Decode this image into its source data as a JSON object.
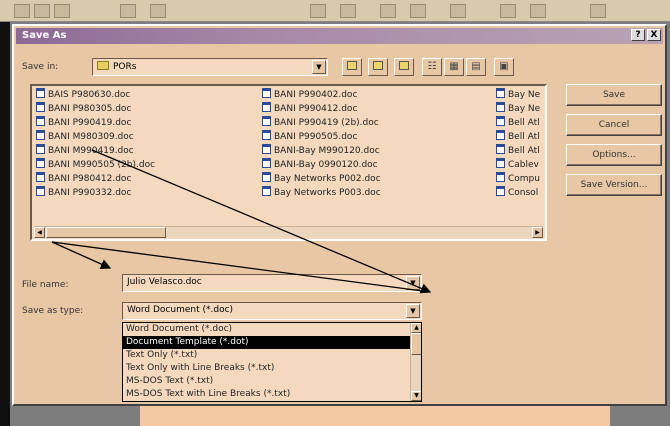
{
  "dialog": {
    "title": "Save As",
    "help_btn": "?",
    "close_btn": "X"
  },
  "save_in": {
    "label": "Save in:",
    "value": "PORs"
  },
  "files": {
    "col1": [
      "BAIS P980630.doc",
      "BANI P980305.doc",
      "BANI P990419.doc",
      "BANI M980309.doc",
      "BANI M990419.doc",
      "BANI M990505 (2b).doc",
      "BANI P980412.doc",
      "BANI P990332.doc"
    ],
    "col2": [
      "BANI P990402.doc",
      "BANI P990412.doc",
      "BANI P990419 (2b).doc",
      "BANI P990505.doc",
      "BANI-Bay M990120.doc",
      "BANI-Bay 0990120.doc",
      "Bay Networks P002.doc",
      "Bay Networks P003.doc"
    ],
    "col3": [
      "Bay Ne",
      "Bay Ne",
      "Bell Atl",
      "Bell Atl",
      "Bell Atl",
      "Cablev",
      "Compu",
      "Consol"
    ]
  },
  "buttons": {
    "save": "Save",
    "cancel": "Cancel",
    "options": "Options...",
    "save_version": "Save Version..."
  },
  "file_name": {
    "label": "File name:",
    "value": "Julio Velasco.doc"
  },
  "save_as_type": {
    "label": "Save as type:",
    "value": "Word Document (*.doc)",
    "options": [
      "Word Document (*.doc)",
      "Document Template (*.dot)",
      "Text Only (*.txt)",
      "Text Only with Line Breaks (*.txt)",
      "MS-DOS Text (*.txt)",
      "MS-DOS Text with Line Breaks (*.txt)"
    ],
    "selected_index": 1
  },
  "colors": {
    "dialog_bg": "#e8c7a4",
    "field_bg": "#f4d9bf",
    "title_gradient_start": "#8d6a95",
    "selection": "#000000"
  }
}
